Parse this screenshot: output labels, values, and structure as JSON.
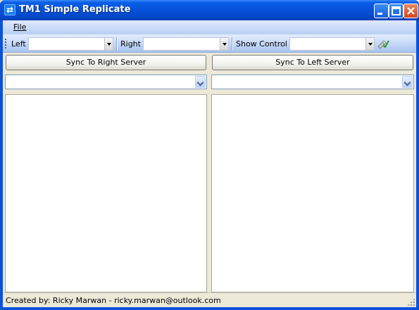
{
  "window": {
    "title": "TM1 Simple Replicate",
    "app_icon": "replicate-arrows-icon"
  },
  "menu": {
    "file_label": "File"
  },
  "toolbar": {
    "left_label": "Left",
    "left_value": "",
    "right_label": "Right",
    "right_value": "",
    "show_control_label": "Show Control",
    "show_control_value": "",
    "action_icon": "check-tool-icon"
  },
  "left_pane": {
    "sync_button_label": "Sync To Right Server",
    "select_value": ""
  },
  "right_pane": {
    "sync_button_label": "Sync To Left Server",
    "select_value": ""
  },
  "status": {
    "text": "Created by: Ricky Marwan - ricky.marwan@outlook.com"
  },
  "colors": {
    "titlebar": "#0550d8",
    "menubar": "#c6d9f7",
    "background": "#ece9d8"
  }
}
